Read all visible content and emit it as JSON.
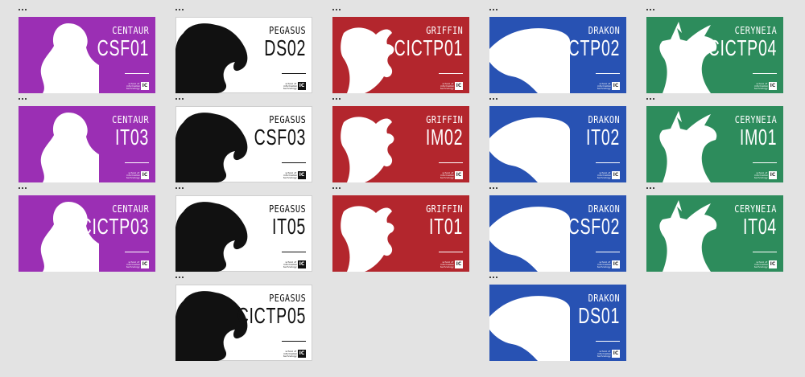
{
  "logo": {
    "text": "school of information technology",
    "mark": "IC"
  },
  "columns": [
    {
      "section": "CENTAUR",
      "theme": "purple",
      "icon": "woman-silhouette-icon",
      "codes": [
        "CSF01",
        "IT03",
        "CICTP03"
      ]
    },
    {
      "section": "PEGASUS",
      "theme": "white",
      "icon": "horse-silhouette-icon",
      "codes": [
        "DS02",
        "CSF03",
        "IT05",
        "CICTP05"
      ]
    },
    {
      "section": "GRIFFIN",
      "theme": "red",
      "icon": "griffin-silhouette-icon",
      "codes": [
        "CICTP01",
        "IM02",
        "IT01"
      ]
    },
    {
      "section": "DRAKON",
      "theme": "blue",
      "icon": "dragon-wing-silhouette-icon",
      "codes": [
        "CICTP02",
        "IT02",
        "CSF02",
        "DS01"
      ]
    },
    {
      "section": "CERYNEIA",
      "theme": "green",
      "icon": "deer-silhouette-icon",
      "codes": [
        "CICTP04",
        "IM01",
        "IT04"
      ]
    }
  ]
}
